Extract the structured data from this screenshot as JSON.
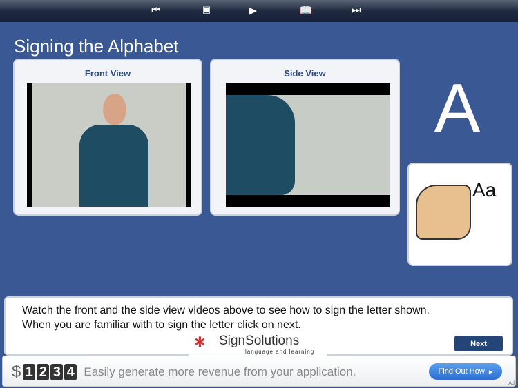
{
  "toolbar": {
    "icons": [
      "skip-back-icon",
      "media-icon",
      "play-icon",
      "book-icon",
      "skip-forward-icon"
    ]
  },
  "title": "Signing the Alphabet",
  "front": {
    "label": "Front View"
  },
  "side": {
    "label": "Side View"
  },
  "letter": "A",
  "card_text": "Aa",
  "message": {
    "line1": "Watch the front and the side view videos above to see how to sign the letter shown.",
    "line2": "When you are familiar with to sign the letter click on next.",
    "next": "Next"
  },
  "logo": {
    "name": "SignSolutions",
    "tagline": "language and learning"
  },
  "ad": {
    "dollar": "$",
    "digits": [
      "1",
      "2",
      "3",
      "4"
    ],
    "text": "Easily generate more revenue from your application.",
    "button": "Find Out How",
    "badge": "iAd"
  }
}
